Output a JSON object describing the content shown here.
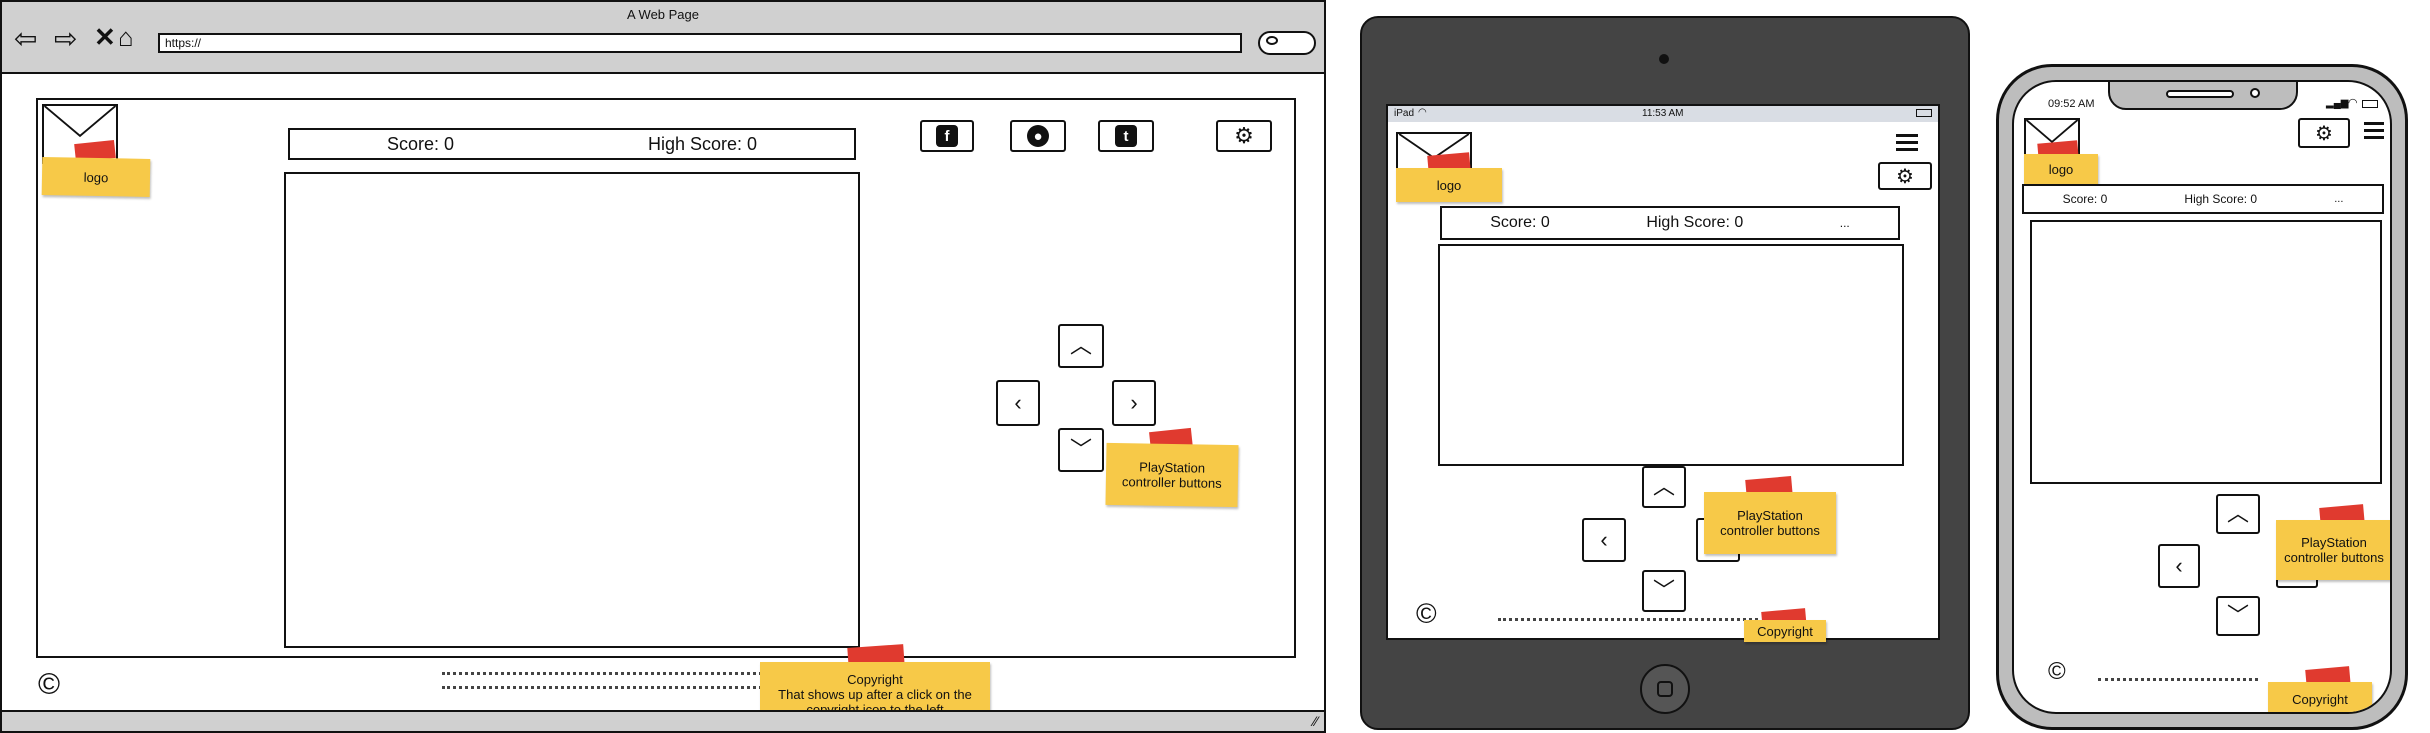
{
  "desktop": {
    "window_title": "A Web Page",
    "url": "https://",
    "logo_note": "logo",
    "score": "Score: 0",
    "high_score": "High Score: 0",
    "controls_note": "PlayStation controller buttons",
    "copyright_symbol": "©",
    "copyright_note_title": "Copyright",
    "copyright_note_body": "That shows up after a click on the copyright icon to the left"
  },
  "tablet": {
    "device": "iPad",
    "time": "11:53 AM",
    "logo_note": "logo",
    "score": "Score: 0",
    "high_score": "High Score: 0",
    "ellipsis": "...",
    "controls_note": "PlayStation controller buttons",
    "copyright_symbol": "©",
    "copyright_note": "Copyright"
  },
  "phone": {
    "time": "09:52 AM",
    "logo_note": "logo",
    "score": "Score: 0",
    "high_score": "High Score: 0",
    "ellipsis": "...",
    "controls_note": "PlayStation controller buttons",
    "copyright_symbol": "©",
    "copyright_note": "Copyright"
  },
  "icons": [
    "facebook-icon",
    "github-icon",
    "twitter-icon",
    "gear-icon",
    "hamburger-menu-icon",
    "arrow-up-icon",
    "arrow-down-icon",
    "arrow-left-icon",
    "arrow-right-icon"
  ],
  "colors": {
    "sticky_note": "#f7c948",
    "tape": "#e03a2f",
    "chrome": "#d0d0d0",
    "tablet_body": "#444444"
  }
}
